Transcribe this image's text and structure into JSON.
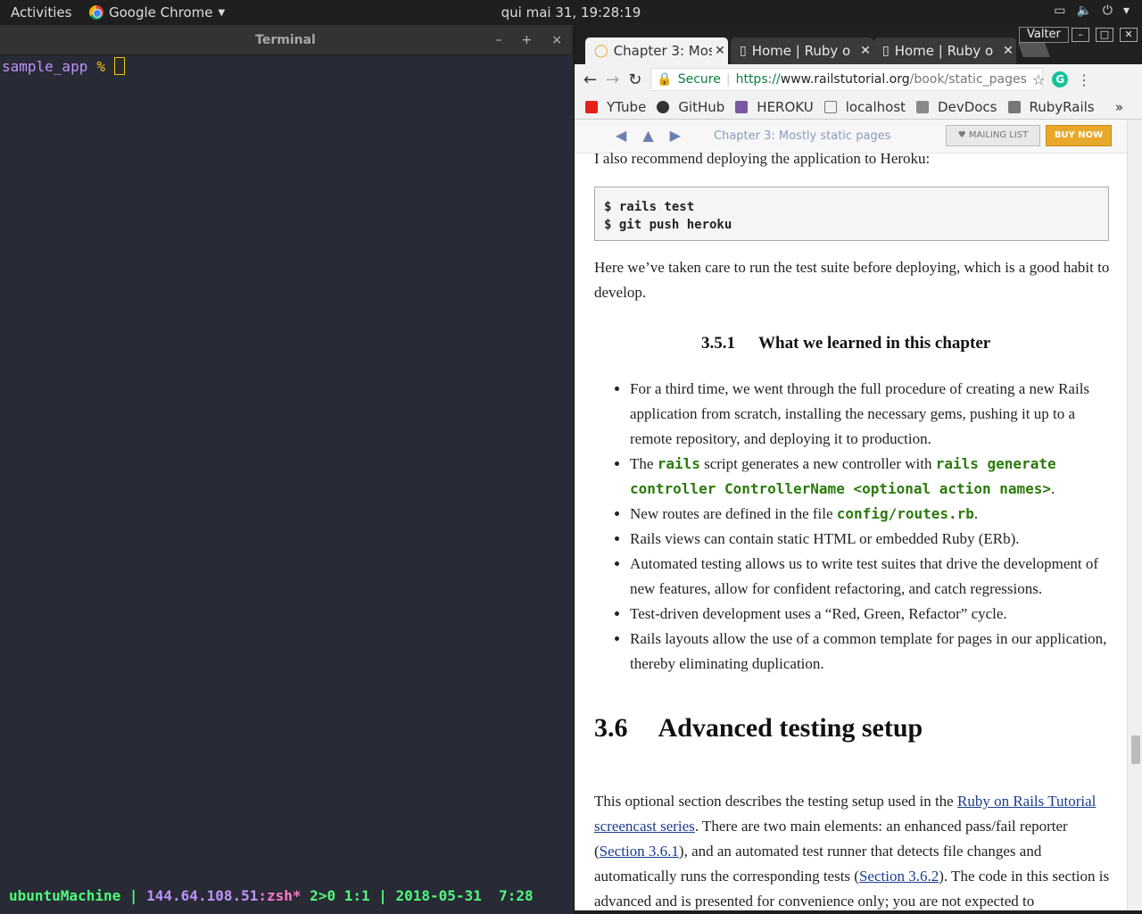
{
  "topbar": {
    "activities": "Activities",
    "app_name": "Google Chrome",
    "clock": "qui mai 31, 19:28:19"
  },
  "terminal": {
    "title": "Terminal",
    "prompt_dir": "sample_app",
    "prompt_symbol": "%",
    "status": {
      "host": "ubuntuMachine",
      "sep1": " | ",
      "ip": "144.64.108.51",
      "shell": ":zsh*",
      "rest": " 2>0 1:1 | 2018-05-31  7:28"
    }
  },
  "browser": {
    "user": "Valter",
    "tabs": [
      {
        "label": "Chapter 3: Mos",
        "active": true
      },
      {
        "label": "Home | Ruby o",
        "active": false
      },
      {
        "label": "Home | Ruby o",
        "active": false
      }
    ],
    "secure_label": "Secure",
    "url": {
      "scheme": "https://",
      "host": "www.railstutorial.org",
      "path": "/book/static_pages"
    },
    "bookmarks": [
      {
        "label": "YTube",
        "icon": "youtube-icon",
        "color": "#e62117"
      },
      {
        "label": "GitHub",
        "icon": "github-icon",
        "color": "#333333"
      },
      {
        "label": "HEROKU",
        "icon": "heroku-icon",
        "color": "#79589f"
      },
      {
        "label": "localhost",
        "icon": "page-icon",
        "color": "#777777"
      },
      {
        "label": "DevDocs",
        "icon": "devdocs-icon",
        "color": "#888888"
      },
      {
        "label": "RubyRails",
        "icon": "folder-icon",
        "color": "#777777"
      }
    ],
    "bookmarks_more": "»"
  },
  "page": {
    "nav_title": "Chapter 3: Mostly static pages",
    "mailing_list": "MAILING LIST",
    "buy_now": "BUY NOW",
    "p1": "I also recommend deploying the application to Heroku:",
    "code_lines": "$ rails test\n$ git push heroku",
    "p2": "Here we’ve taken care to run the test suite before deploying, which is a good habit to develop.",
    "h3_num": "3.5.1",
    "h3_text": "What we learned in this chapter",
    "bullets": {
      "b1": "For a third time, we went through the full procedure of creating a new Rails application from scratch, installing the necessary gems, pushing it up to a remote repository, and deploying it to production.",
      "b2_a": "The ",
      "b2_code1": "rails",
      "b2_b": " script generates a new controller with ",
      "b2_code2": "rails generate controller ControllerName <optional action names>",
      "b2_c": ".",
      "b3_a": "New routes are defined in the file ",
      "b3_code": "config/routes.rb",
      "b3_b": ".",
      "b4": "Rails views can contain static HTML or embedded Ruby (ERb).",
      "b5": "Automated testing allows us to write test suites that drive the development of new features, allow for confident refactoring, and catch regressions.",
      "b6": "Test-driven development uses a “Red, Green, Refactor” cycle.",
      "b7": "Rails layouts allow the use of a common template for pages in our application, thereby eliminating duplication."
    },
    "h2_num": "3.6",
    "h2_text": "Advanced testing setup",
    "p3": {
      "a": "This optional section describes the testing setup used in the ",
      "link1": "Ruby on Rails Tutorial screencast series",
      "b": ".  There are two main elements: an enhanced pass/fail reporter (",
      "link2": "Section 3.6.1",
      "c": "), and an automated test runner that detects file changes and automatically runs the corresponding tests (",
      "link3": "Section 3.6.2",
      "d": ").  The code in this section is advanced and is presented for convenience only; you are not expected to"
    }
  }
}
